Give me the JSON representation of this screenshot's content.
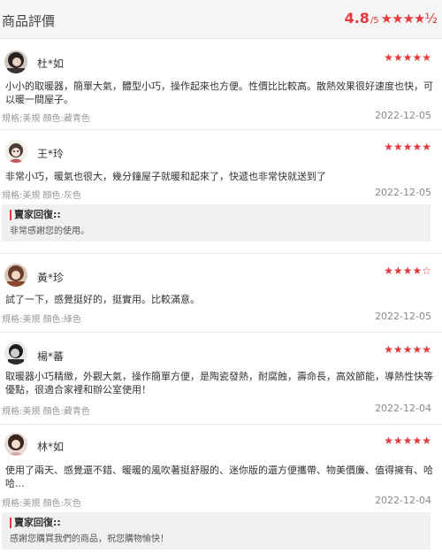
{
  "header": {
    "title": "商品評價",
    "rating": "4.8",
    "rating_suffix": "/5",
    "stars": "★★★★½"
  },
  "reviews": [
    {
      "user": "杜*如",
      "stars": "★★★★★",
      "rating": 5,
      "text": "小小的取暖器，簡單大氣，體型小巧，操作起來也方便。性價比比較高。散熱效果很好速度也快，可以暖一間屋子。",
      "spec": "規格:美規 顏色:藏青色",
      "date": "2022-12-05",
      "avatar": "avatar-dark-hair"
    },
    {
      "user": "王*玲",
      "stars": "★★★★★",
      "rating": 5,
      "text": "非常小巧，暖氣也很大，幾分鐘屋子就暖和起來了，快遞也非常快就送到了",
      "spec": "規格:美規 顏色:灰色",
      "date": "2022-12-05",
      "avatar": "avatar-cartoon",
      "reply_title": "賣家回復::",
      "reply_text": "非常感謝您的使用。"
    },
    {
      "user": "黃*珍",
      "stars": "★★★★",
      "stars_empty": "☆",
      "rating": 4,
      "text": "試了一下，感覺挺好的，挺實用。比較滿意。",
      "spec": "規格:美規 顏色:綠色",
      "date": "2022-12-05",
      "avatar": "avatar-brown-hair"
    },
    {
      "user": "楊*蕃",
      "stars": "★★★★★",
      "rating": 5,
      "text": "取暖器小巧精緻，外觀大氣，操作簡單方便，是陶瓷發熱，耐腐蝕，壽命長，高效節能，導熱性快等優點，很適合家裡和辦公室使用！",
      "spec": "規格:美規 顏色:藏青色",
      "date": "2022-12-04",
      "avatar": "avatar-bw-portrait"
    },
    {
      "user": "林*如",
      "stars": "★★★★★",
      "rating": 5,
      "text": "使用了兩天、感覺還不錯、暖暖的風吹著挺舒服的、迷你版的還方便攜帶、物美價廉、值得擁有、哈哈...",
      "spec": "規格:美規 顏色:灰色",
      "date": "2022-12-04",
      "avatar": "avatar-girl",
      "reply_title": "賣家回復::",
      "reply_text": "感謝您購買我們的商品，祝您購物愉快！"
    }
  ]
}
